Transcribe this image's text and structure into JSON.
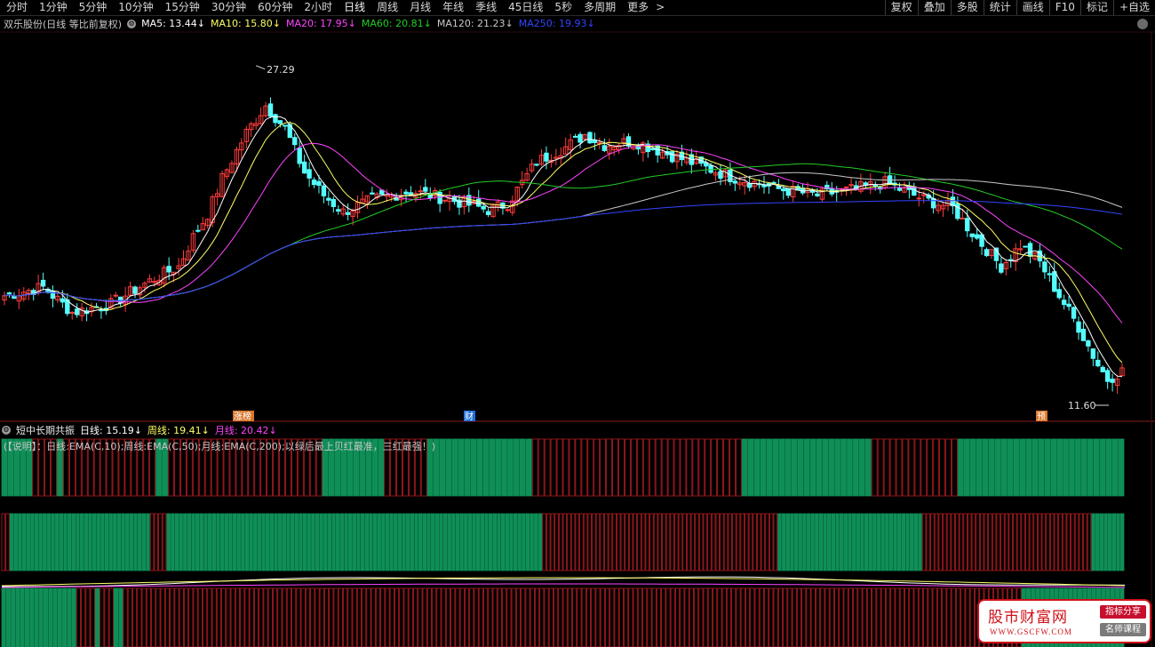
{
  "toolbar": {
    "periods": [
      "分时",
      "1分钟",
      "5分钟",
      "10分钟",
      "15分钟",
      "30分钟",
      "60分钟",
      "2小时",
      "日线",
      "周线",
      "月线",
      "年线",
      "季线",
      "45日线",
      "5秒",
      "多周期",
      "更多"
    ],
    "active_period": "日线",
    "more_arrow": ">",
    "tools": [
      "复权",
      "叠加",
      "多股",
      "统计",
      "画线",
      "F10",
      "标记",
      "+自选"
    ]
  },
  "legend": {
    "stock": "双乐股份(日线 等比前复权)",
    "ma": [
      {
        "label": "MA5: 13.44",
        "arrow": "↓",
        "color": "#ffffff"
      },
      {
        "label": "MA10: 15.80",
        "arrow": "↓",
        "color": "#ffff66"
      },
      {
        "label": "MA20: 17.95",
        "arrow": "↓",
        "color": "#ff44ff"
      },
      {
        "label": "MA60: 20.81",
        "arrow": "↓",
        "color": "#22cc22"
      },
      {
        "label": "MA120: 21.23",
        "arrow": "↓",
        "color": "#c8c8c8"
      },
      {
        "label": "MA250: 19.93",
        "arrow": "↓",
        "color": "#3344ff"
      }
    ]
  },
  "price_chart": {
    "high_label": "27.29",
    "low_label": "11.60",
    "event_markers": [
      "涨榜",
      "财",
      "预"
    ]
  },
  "indicator": {
    "name": "短中长期共振",
    "values": [
      {
        "label": "日线: 15.19",
        "arrow": "↓",
        "color": "#ffffff"
      },
      {
        "label": "周线: 19.41",
        "arrow": "↓",
        "color": "#ffff66"
      },
      {
        "label": "月线: 20.42",
        "arrow": "↓",
        "color": "#ff44ff"
      }
    ],
    "note": "(【说明】：日线:EMA(C,10);周线:EMA(C,50);月线:EMA(C,200);以绿后最上贝红最准，三红最强！)",
    "row1": "GGGGGRRRRGRRRRRRRRRRRRRRRGGRRRRRRRRRRRRRRRRRRRRRRRRRGGGGGGGGGGRRRRRRRGGGGGGGGGGGGGGGGGRRRRRRRRRRRRRRRRRRRRRRRRRRRRRRRRRRGGGGGGGGGGGGGGGGGGGGGRRRRRRRRRRRRRRGGGGGGGGGGGGGGGGGGGGGGGGGGG",
    "row2": "RRGGGGGGGGGGGGGGGGGGGGGGGGGGGGGGGGGGRRRRGGGGGGGGGGGGGGGGGGGGGGGGGGGGGGGGGGGGGGGGGGGGGGGGGGGGGGGGGGGGGGGGGGGGGGGGGGGGGGGGGGGGGGGGGGGRRRRRRRRRRRRRRRRRRRRRRRRRRRRRRRRRRRRRRRRRRRRRRRRRRRRRRRRRGGGGGGGGGGGGGGGGGGGGGGGGGGGGGGGGGGGRRRRRRRRRRRRRRRRRRRRRRRRRRRRRRRRRRRRRRRRRGGGGGGGG",
    "row3": "GGGGGGGGGGGGGGGGRRRRGRRRGGRRRRRRRRRRRRRRRRRRRRRRRRRRRRRRRRRRRRRRRRRRRRRRRRRRRRRRRRRRRRRRRRRRRRRRRRRRRRRRRRRRRRRRRRRRRRRRRRRRRRRRRRRRRRRRRRRRRRRRRRRRRRRRRRRRRRRRRRRRRRRRRRRRRRRRRRRRRRRRRRRRRRRRRRRRRRRRRRRRRRRRRRRRRRRRRRGGGGGGGGGGGGGGGGGGGGGG"
  },
  "watermark": {
    "title": "股市财富网",
    "url": "WWW.GSCFW.COM",
    "tag1": "指标分享",
    "tag2": "名师课程"
  },
  "colors": {
    "up": "#ff3b3b",
    "down": "#54ffff",
    "green_bar": "#0f8f58",
    "red_bar": "#b01c22"
  }
}
